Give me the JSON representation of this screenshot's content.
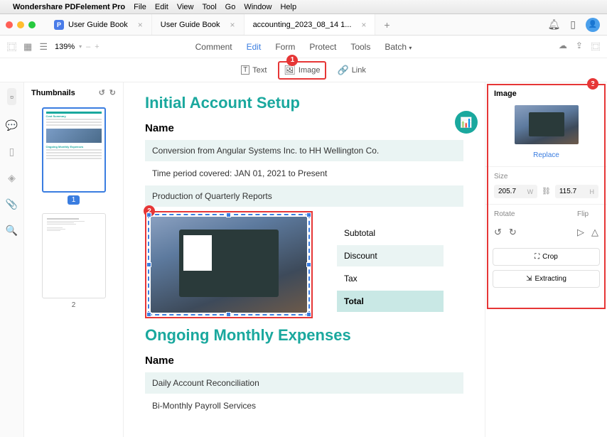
{
  "menubar": {
    "appname": "Wondershare PDFelement Pro",
    "items": [
      "File",
      "Edit",
      "View",
      "Tool",
      "Go",
      "Window",
      "Help"
    ]
  },
  "tabs": [
    {
      "label": "User Guide Book",
      "active": false
    },
    {
      "label": "User Guide Book",
      "active": false
    },
    {
      "label": "accounting_2023_08_14 1...",
      "active": true
    }
  ],
  "zoom": {
    "value": "139%",
    "minus": "–",
    "plus": "+"
  },
  "toolbar_tabs": [
    "Comment",
    "Edit",
    "Form",
    "Protect",
    "Tools",
    "Batch"
  ],
  "active_toolbar_tab": "Edit",
  "toolbar2": {
    "text": "Text",
    "image": "Image",
    "link": "Link"
  },
  "thumbnails": {
    "title": "Thumbnails",
    "pages": [
      "1",
      "2"
    ],
    "selected": "1"
  },
  "doc": {
    "h1a": "Initial Account Setup",
    "name": "Name",
    "r1": "Conversion from Angular Systems Inc. to HH Wellington Co.",
    "r2": "Time period covered: JAN 01, 2021 to Present",
    "r3": "Production of Quarterly Reports",
    "subtotal": "Subtotal",
    "discount": "Discount",
    "tax": "Tax",
    "total": "Total",
    "h1b": "Ongoing Monthly Expenses",
    "name2": "Name",
    "r4": "Daily Account Reconciliation",
    "r5": "Bi-Monthly Payroll Services"
  },
  "side": {
    "title": "Image",
    "replace": "Replace",
    "size_label": "Size",
    "width": "205.7",
    "w": "W",
    "height": "115.7",
    "h": "H",
    "rotate": "Rotate",
    "flip": "Flip",
    "crop": "Crop",
    "extract": "Extracting"
  },
  "callouts": {
    "1": "1",
    "2": "2",
    "3": "3"
  }
}
